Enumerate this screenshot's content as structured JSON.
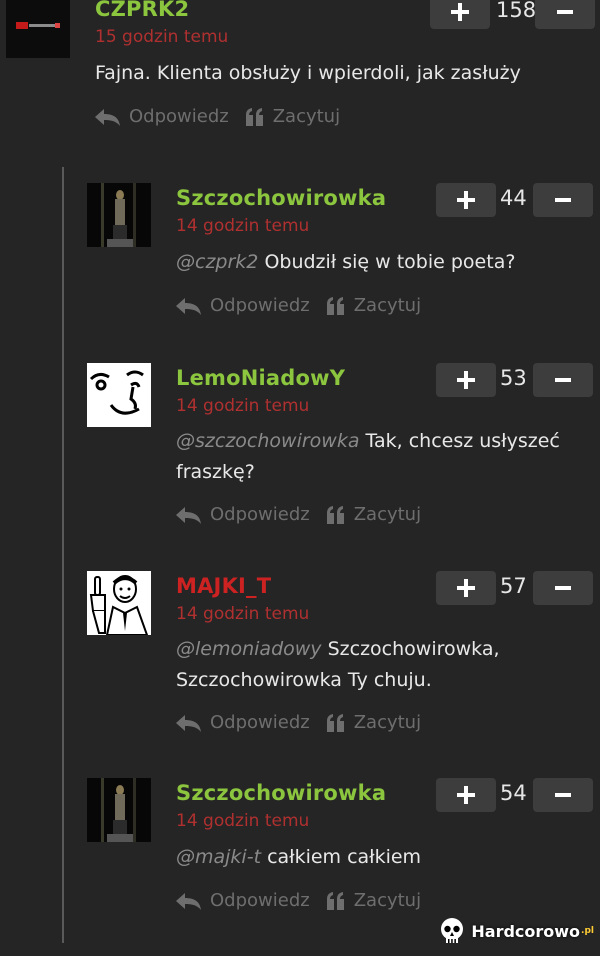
{
  "accent_colors": {
    "green_author": "#8cc63f",
    "red_author": "#cc2222",
    "time_red": "#b03030",
    "background": "#252525"
  },
  "comments": [
    {
      "author": "CZPRK2",
      "author_color": "#8cc63f",
      "time": "15 godzin temu",
      "mention": "",
      "text": "Fajna. Klienta obsłuży i wpierdoli, jak zasłuży",
      "score": "158",
      "avatar": "czprk2-avatar"
    },
    {
      "author": "Szczochowirowka",
      "author_color": "#8cc63f",
      "time": "14 godzin temu",
      "mention": "@czprk2",
      "text": "Obudził się w tobie poeta?",
      "score": "44",
      "avatar": "dark-figure-avatar"
    },
    {
      "author": "LemoNiadowY",
      "author_color": "#8cc63f",
      "time": "14 godzin temu",
      "mention": "@szczochowirowka",
      "text": "Tak, chcesz usłyszeć fraszkę?",
      "score": "53",
      "avatar": "lenny-face-avatar"
    },
    {
      "author": "MAJKI_T",
      "author_color": "#cc2222",
      "time": "14 godzin temu",
      "mention": "@lemoniadowy",
      "text": "Szczochowirowka, Szczochowirowka Ty chuju.",
      "score": "57",
      "avatar": "middle-finger-man-avatar"
    },
    {
      "author": "Szczochowirowka",
      "author_color": "#8cc63f",
      "time": "14 godzin temu",
      "mention": "@majki-t",
      "text": "całkiem całkiem",
      "score": "54",
      "avatar": "dark-figure-avatar"
    }
  ],
  "actions": {
    "reply_label": "Odpowiedz",
    "quote_label": "Zacytuj",
    "reply_icon": "reply-arrow-icon",
    "quote_icon": "quote-icon"
  },
  "watermark": {
    "text": "Hardcorowo",
    "suffix": ".pl",
    "icon": "skull-icon"
  }
}
